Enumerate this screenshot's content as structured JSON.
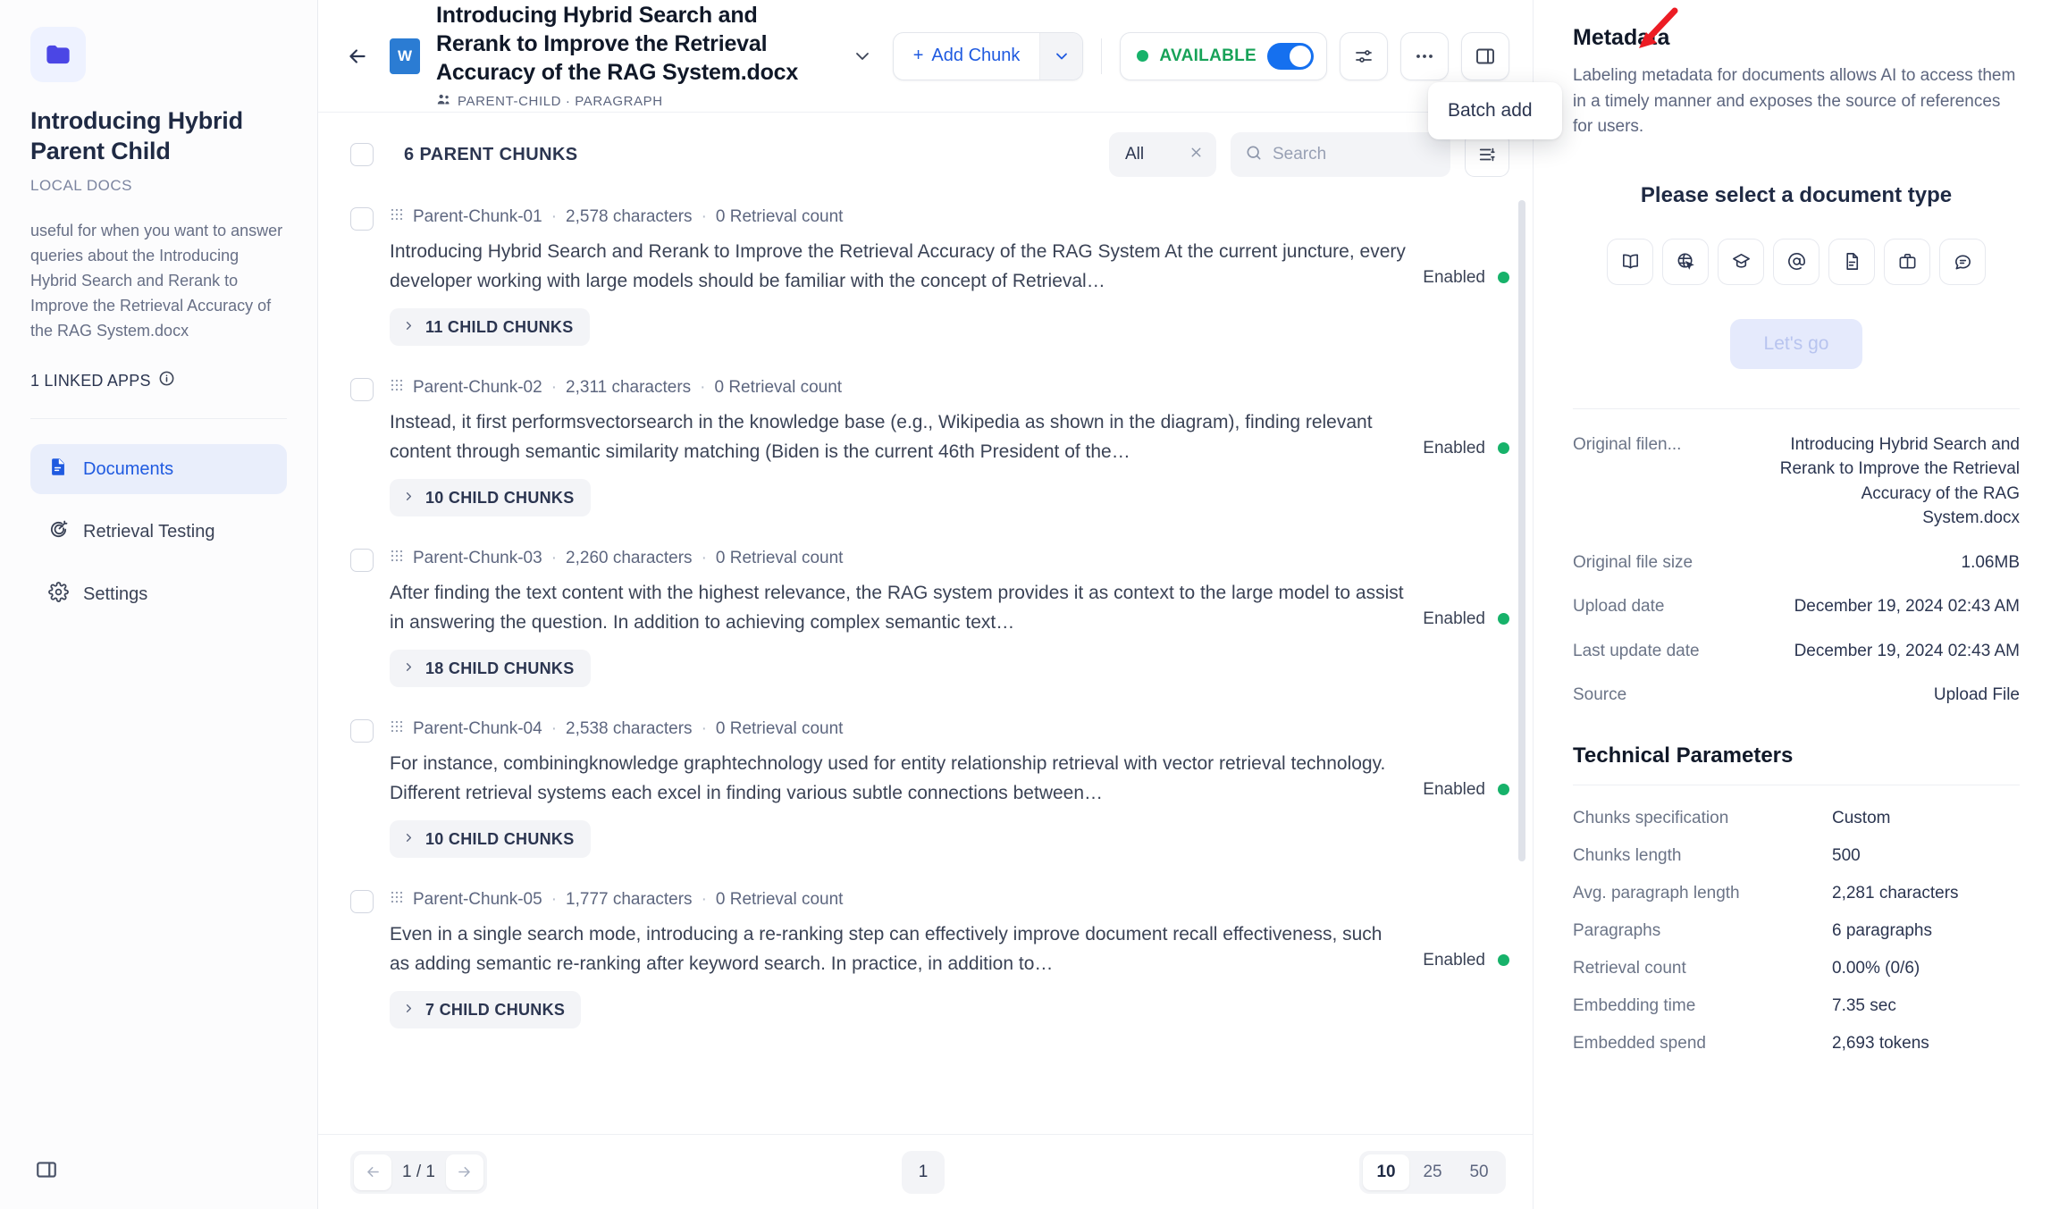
{
  "sidebar": {
    "dataset_title": "Introducing Hybrid Parent Child",
    "dataset_kind": "LOCAL DOCS",
    "dataset_description": "useful for when you want to answer queries about the Introducing Hybrid Search and Rerank to Improve the Retrieval Accuracy of the RAG System.docx",
    "linked_apps": "1 LINKED APPS",
    "items": [
      {
        "label": "Documents",
        "icon": "document-icon",
        "active": true
      },
      {
        "label": "Retrieval Testing",
        "icon": "target-icon",
        "active": false
      },
      {
        "label": "Settings",
        "icon": "gear-icon",
        "active": false
      }
    ],
    "collapse_icon": "panel-collapse-icon"
  },
  "header": {
    "back_icon": "arrow-left-icon",
    "file_icon_letter": "W",
    "doc_title": "Introducing Hybrid Search and Rerank to Improve the Retrieval Accuracy of the RAG System.docx",
    "doc_subtitle": "PARENT-CHILD · PARAGRAPH",
    "title_caret_icon": "chevron-down-icon",
    "add_chunk_label": "Add Chunk",
    "add_chunk_plus": "+",
    "add_chunk_caret_icon": "chevron-down-icon",
    "available_label": "AVAILABLE",
    "available_on": true,
    "settings_icon": "sliders-icon",
    "more_icon": "ellipsis-icon",
    "panel_icon": "right-panel-icon"
  },
  "dropdown": {
    "items": [
      {
        "label": "Batch add"
      }
    ]
  },
  "toolbar": {
    "chunks_count_label": "6 PARENT CHUNKS",
    "filter_value": "All",
    "filter_clear_icon": "close-icon",
    "search_placeholder": "Search",
    "search_value": "",
    "search_icon": "search-icon",
    "list_mode_icon": "list-settings-icon"
  },
  "chunks": [
    {
      "id": "Parent-Chunk-01",
      "characters": "2,578 characters",
      "retrieval": "0 Retrieval count",
      "text": "Introducing Hybrid Search and Rerank to Improve the Retrieval Accuracy of the RAG System At the current juncture, every developer working with large models should be familiar with the concept of Retrieval…",
      "children": "11 CHILD CHUNKS",
      "status": "Enabled"
    },
    {
      "id": "Parent-Chunk-02",
      "characters": "2,311 characters",
      "retrieval": "0 Retrieval count",
      "text": "Instead, it first performsvectorsearch in the knowledge base (e.g., Wikipedia as shown in the diagram), finding relevant content through semantic similarity matching (Biden is the current 46th President of the…",
      "children": "10 CHILD CHUNKS",
      "status": "Enabled"
    },
    {
      "id": "Parent-Chunk-03",
      "characters": "2,260 characters",
      "retrieval": "0 Retrieval count",
      "text": "After finding the text content with the highest relevance, the RAG system provides it as context to the large model to assist in answering the question. In addition to achieving complex semantic text…",
      "children": "18 CHILD CHUNKS",
      "status": "Enabled"
    },
    {
      "id": "Parent-Chunk-04",
      "characters": "2,538 characters",
      "retrieval": "0 Retrieval count",
      "text": "For instance, combiningknowledge graphtechnology used for entity relationship retrieval with vector retrieval technology. Different retrieval systems each excel in finding various subtle connections between…",
      "children": "10 CHILD CHUNKS",
      "status": "Enabled"
    },
    {
      "id": "Parent-Chunk-05",
      "characters": "1,777 characters",
      "retrieval": "0 Retrieval count",
      "text": "Even in a single search mode, introducing a re-ranking step can effectively improve document recall effectiveness, such as adding semantic re-ranking after keyword search. In practice, in addition to…",
      "children": "7 CHILD CHUNKS",
      "status": "Enabled"
    }
  ],
  "pager": {
    "prev_icon": "arrow-left-icon",
    "next_icon": "arrow-right-icon",
    "page_label": "1 / 1",
    "current_page": "1",
    "sizes": [
      "10",
      "25",
      "50"
    ],
    "selected_size": "10"
  },
  "right_panel": {
    "metadata_title": "Metadata",
    "metadata_desc": "Labeling metadata for documents allows AI to access them in a timely manner and exposes the source of references for users.",
    "select_type_title": "Please select a document type",
    "type_icons": [
      "book-icon",
      "globe-cursor-icon",
      "graduation-cap-icon",
      "at-sign-icon",
      "file-text-icon",
      "briefcase-icon",
      "chat-bubble-icon"
    ],
    "lets_go_label": "Let's go",
    "fields": [
      {
        "key": "Original filen...",
        "value": "Introducing Hybrid Search and Rerank to Improve the Retrieval Accuracy of the RAG System.docx"
      },
      {
        "key": "Original file size",
        "value": "1.06MB"
      },
      {
        "key": "Upload date",
        "value": "December 19, 2024 02:43 AM"
      },
      {
        "key": "Last update date",
        "value": "December 19, 2024 02:43 AM"
      },
      {
        "key": "Source",
        "value": "Upload File"
      }
    ],
    "tech_title": "Technical Parameters",
    "tech_fields": [
      {
        "key": "Chunks specification",
        "value": "Custom"
      },
      {
        "key": "Chunks length",
        "value": "500"
      },
      {
        "key": "Avg. paragraph length",
        "value": "2,281 characters"
      },
      {
        "key": "Paragraphs",
        "value": "6 paragraphs"
      },
      {
        "key": "Retrieval count",
        "value": "0.00% (0/6)"
      },
      {
        "key": "Embedding time",
        "value": "7.35 sec"
      },
      {
        "key": "Embedded spend",
        "value": "2,693 tokens"
      }
    ]
  },
  "colors": {
    "accent": "#1f5ae0",
    "available_green": "#17a258",
    "toggle_on": "#1570ef",
    "annotation_red": "#ec1c24"
  }
}
